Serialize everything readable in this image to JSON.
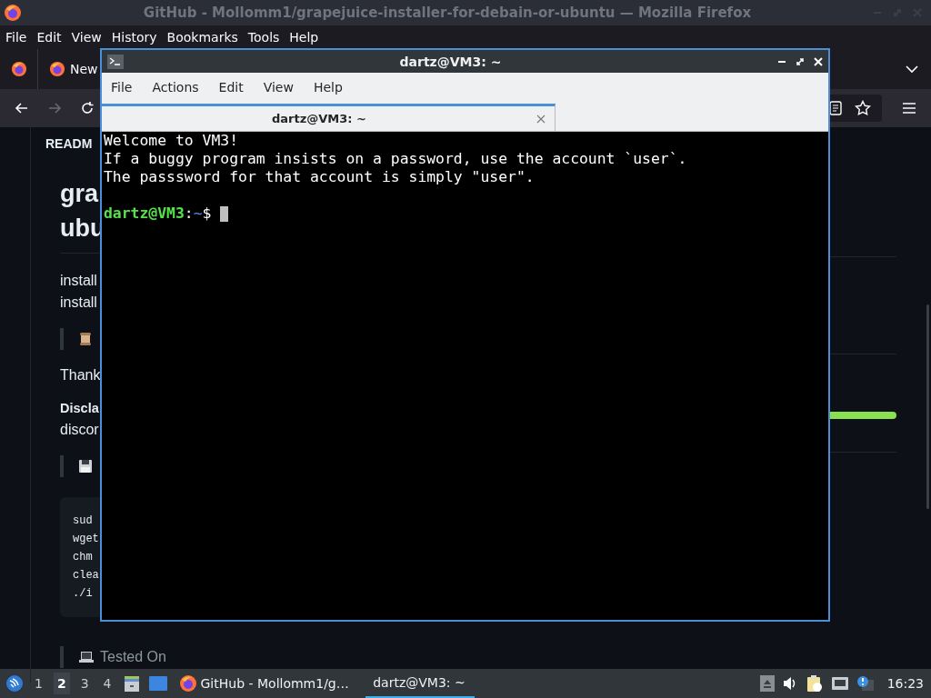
{
  "firefox": {
    "title": "GitHub - Mollomm1/grapejuice-installer-for-debain-or-ubuntu — Mozilla Firefox",
    "menu": [
      {
        "label": "File"
      },
      {
        "label": "Edit"
      },
      {
        "label": "View"
      },
      {
        "label": "History"
      },
      {
        "label": "Bookmarks"
      },
      {
        "label": "Tools"
      },
      {
        "label": "Help"
      }
    ],
    "tab": {
      "label": "New"
    },
    "nav": {
      "forward_disabled": true
    },
    "page": {
      "header": "READM",
      "heading_lines": [
        "gra",
        "ubu"
      ],
      "intro_lines": [
        "install",
        "install"
      ],
      "blocks": [
        {
          "kind": "quote"
        },
        {
          "kind": "text",
          "text": "Thank"
        },
        {
          "kind": "bold",
          "text": "Discla"
        },
        {
          "kind": "text",
          "text": "discor"
        },
        {
          "kind": "quote"
        },
        {
          "kind": "code",
          "lines": [
            "sud",
            "wget",
            "chm",
            "clea",
            "./i"
          ]
        },
        {
          "kind": "quote",
          "text": "Tested On"
        }
      ]
    }
  },
  "terminal": {
    "title": "dartz@VM3: ~",
    "menu": [
      {
        "label": "File"
      },
      {
        "label": "Actions"
      },
      {
        "label": "Edit"
      },
      {
        "label": "View"
      },
      {
        "label": "Help"
      }
    ],
    "tabs": [
      {
        "label": "dartz@VM3: ~",
        "selected": true
      }
    ],
    "lines": [
      "Welcome to VM3!",
      "If a buggy program insists on a password, use the account `user`.",
      "The passsword for that account is simply \"user\"."
    ],
    "prompt": {
      "user_host": "dartz@VM3",
      "separator": ":",
      "path": "~",
      "symbol": "$"
    }
  },
  "taskbar": {
    "workspaces": [
      {
        "label": "1",
        "selected": false
      },
      {
        "label": "2",
        "selected": true
      },
      {
        "label": "3",
        "selected": false
      },
      {
        "label": "4",
        "selected": false
      }
    ],
    "tasks": [
      {
        "kind": "firefox",
        "label": "GitHub - Mollomm1/g…",
        "active": false
      },
      {
        "kind": "terminal",
        "label": "dartz@VM3: ~",
        "active": true
      }
    ],
    "clock": "16:23"
  }
}
